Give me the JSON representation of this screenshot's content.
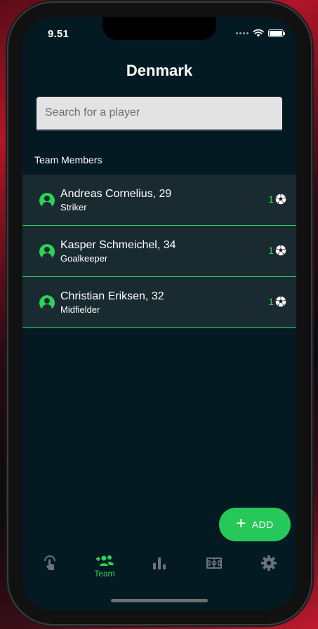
{
  "status_bar": {
    "time": "9.51"
  },
  "header": {
    "title": "Denmark"
  },
  "search": {
    "placeholder": "Search for a player",
    "value": ""
  },
  "section": {
    "label": "Team Members"
  },
  "players": [
    {
      "name": "Andreas Cornelius, 29",
      "position": "Striker",
      "goals": "1"
    },
    {
      "name": "Kasper Schmeichel, 34",
      "position": "Goalkeeper",
      "goals": "1"
    },
    {
      "name": "Christian Eriksen, 32",
      "position": "Midfielder",
      "goals": "1"
    }
  ],
  "fab": {
    "label": "ADD",
    "icon": "plus-icon"
  },
  "tabbar": {
    "items": [
      {
        "icon": "tap-gesture-icon",
        "label": "",
        "active": false
      },
      {
        "icon": "team-add-icon",
        "label": "Team",
        "active": true
      },
      {
        "icon": "bar-chart-icon",
        "label": "",
        "active": false
      },
      {
        "icon": "soccer-field-icon",
        "label": "",
        "active": false
      },
      {
        "icon": "gear-icon",
        "label": "",
        "active": false
      }
    ]
  },
  "colors": {
    "background": "#031a23",
    "row": "#1a2a31",
    "accent": "#2bd35a",
    "fab": "#27c85a",
    "inactive_icon": "#6b7378"
  }
}
